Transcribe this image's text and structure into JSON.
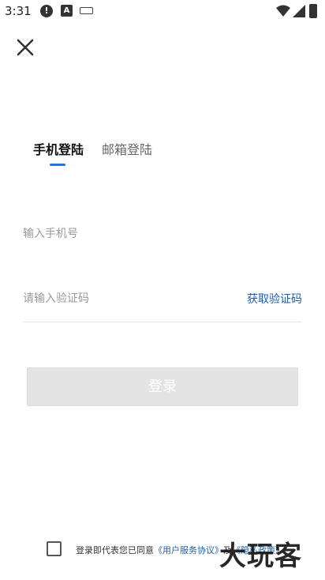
{
  "status_bar": {
    "time": "3:31"
  },
  "icons": {
    "close": "close-icon",
    "wifi": "wifi-icon",
    "signal": "signal-icon",
    "battery": "battery-icon"
  },
  "tabs": [
    {
      "label": "手机登陆",
      "active": true
    },
    {
      "label": "邮箱登陆",
      "active": false
    }
  ],
  "form": {
    "phone_placeholder": "输入手机号",
    "phone_value": "",
    "code_placeholder": "请输入验证码",
    "code_value": "",
    "get_code_label": "获取验证码",
    "login_label": "登录"
  },
  "agreement": {
    "prefix": "登录即代表您已同意",
    "user_agreement": "《用户服务协议》",
    "conjunction": "及",
    "privacy_policy": "《隐私政策》"
  },
  "watermark": "大玩客",
  "colors": {
    "accent": "#1a73e8",
    "link": "#1a5fb4",
    "login_disabled_bg": "#e4e4e4"
  }
}
